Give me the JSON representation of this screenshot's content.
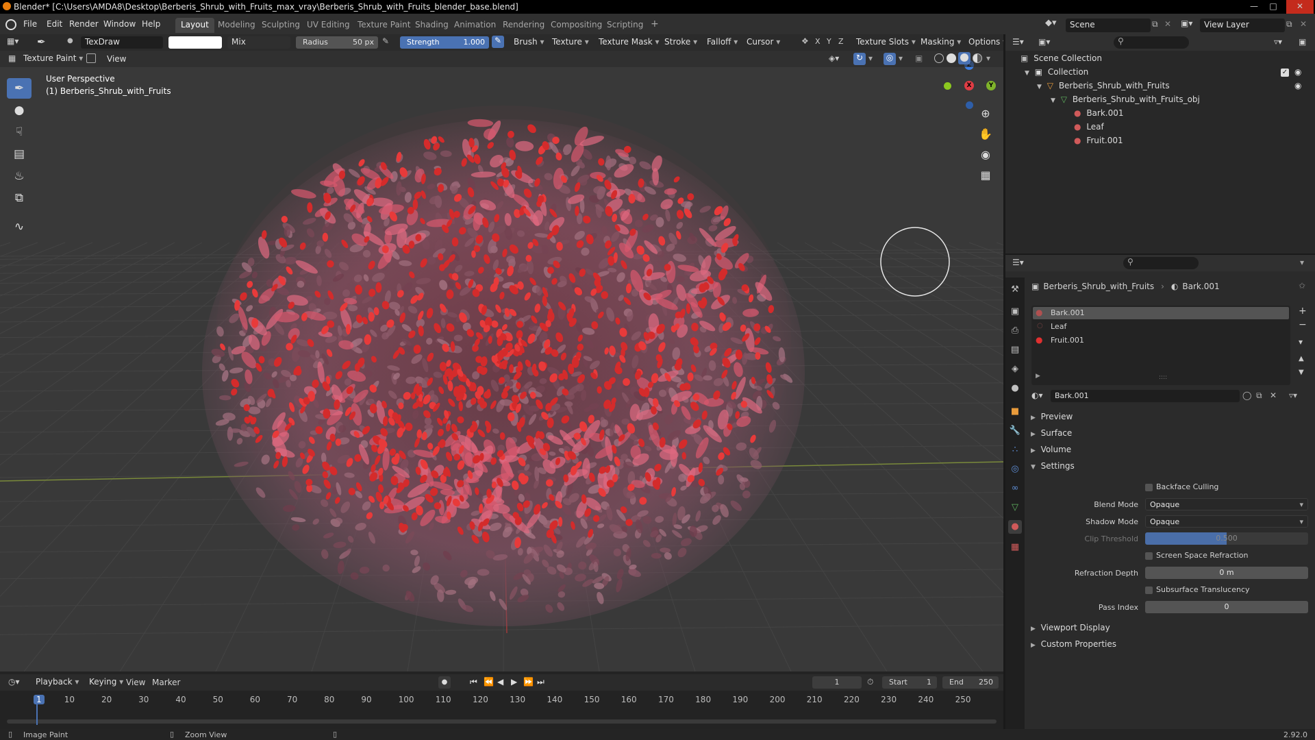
{
  "window": {
    "title": "Blender* [C:\\Users\\AMDA8\\Desktop\\Berberis_Shrub_with_Fruits_max_vray\\Berberis_Shrub_with_Fruits_blender_base.blend]"
  },
  "menu": {
    "items": [
      "File",
      "Edit",
      "Render",
      "Window",
      "Help"
    ],
    "workspaces": [
      "Layout",
      "Modeling",
      "Sculpting",
      "UV Editing",
      "Texture Paint",
      "Shading",
      "Animation",
      "Rendering",
      "Compositing",
      "Scripting"
    ],
    "active_workspace": "Layout",
    "add_tab": "+",
    "scene": "Scene",
    "view_layer": "View Layer"
  },
  "tool_header": {
    "brush_name": "TexDraw",
    "blend": "Mix",
    "radius_label": "Radius",
    "radius_value": "50 px",
    "strength_label": "Strength",
    "strength_value": "1.000",
    "menus": [
      "Brush",
      "Texture",
      "Texture Mask",
      "Stroke",
      "Falloff",
      "Cursor"
    ],
    "axes": [
      "X",
      "Y",
      "Z"
    ],
    "texture_slots": "Texture Slots",
    "masking": "Masking",
    "options": "Options"
  },
  "view_header": {
    "mode": "Texture Paint",
    "view": "View"
  },
  "viewport": {
    "perspective": "User Perspective",
    "object_label": "(1) Berberis_Shrub_with_Fruits",
    "gizmo": {
      "x": "X",
      "y": "Y",
      "z": "Z"
    },
    "colors": {
      "bg": "#393939",
      "grid": "#454545",
      "fruit": "#d42b2b",
      "leaf": "#6a4b55",
      "accent": "#4a72b3"
    }
  },
  "outliner": {
    "scene_collection": "Scene Collection",
    "rows": [
      {
        "label": "Collection",
        "indent": 0
      },
      {
        "label": "Berberis_Shrub_with_Fruits",
        "indent": 1
      },
      {
        "label": "Berberis_Shrub_with_Fruits_obj",
        "indent": 2
      },
      {
        "label": "Bark.001",
        "indent": 3
      },
      {
        "label": "Leaf",
        "indent": 3
      },
      {
        "label": "Fruit.001",
        "indent": 3
      }
    ]
  },
  "properties": {
    "breadcrumb_object": "Berberis_Shrub_with_Fruits",
    "breadcrumb_material": "Bark.001",
    "slots": [
      "Bark.001",
      "Leaf",
      "Fruit.001"
    ],
    "active_slot": "Bark.001",
    "material_name": "Bark.001",
    "panels": [
      "Preview",
      "Surface",
      "Volume",
      "Settings"
    ],
    "backface_culling": "Backface Culling",
    "blend_mode_label": "Blend Mode",
    "blend_mode": "Opaque",
    "shadow_mode_label": "Shadow Mode",
    "shadow_mode": "Opaque",
    "clip_threshold_label": "Clip Threshold",
    "clip_threshold": "0.500",
    "ssr": "Screen Space Refraction",
    "refraction_depth_label": "Refraction Depth",
    "refraction_depth": "0 m",
    "subsurface": "Subsurface Translucency",
    "pass_index_label": "Pass Index",
    "pass_index": "0",
    "more_panels": [
      "Viewport Display",
      "Custom Properties"
    ]
  },
  "timeline": {
    "menus": [
      "Playback",
      "Keying",
      "View",
      "Marker"
    ],
    "current_frame": "1",
    "start_label": "Start",
    "start": "1",
    "end_label": "End",
    "end": "250",
    "ticks": [
      "1",
      "10",
      "20",
      "30",
      "40",
      "50",
      "60",
      "70",
      "80",
      "90",
      "100",
      "110",
      "120",
      "130",
      "140",
      "150",
      "160",
      "170",
      "180",
      "190",
      "200",
      "210",
      "220",
      "230",
      "240",
      "250"
    ]
  },
  "status": {
    "left": "Image Paint",
    "middle": "Zoom View",
    "version": "2.92.0"
  }
}
